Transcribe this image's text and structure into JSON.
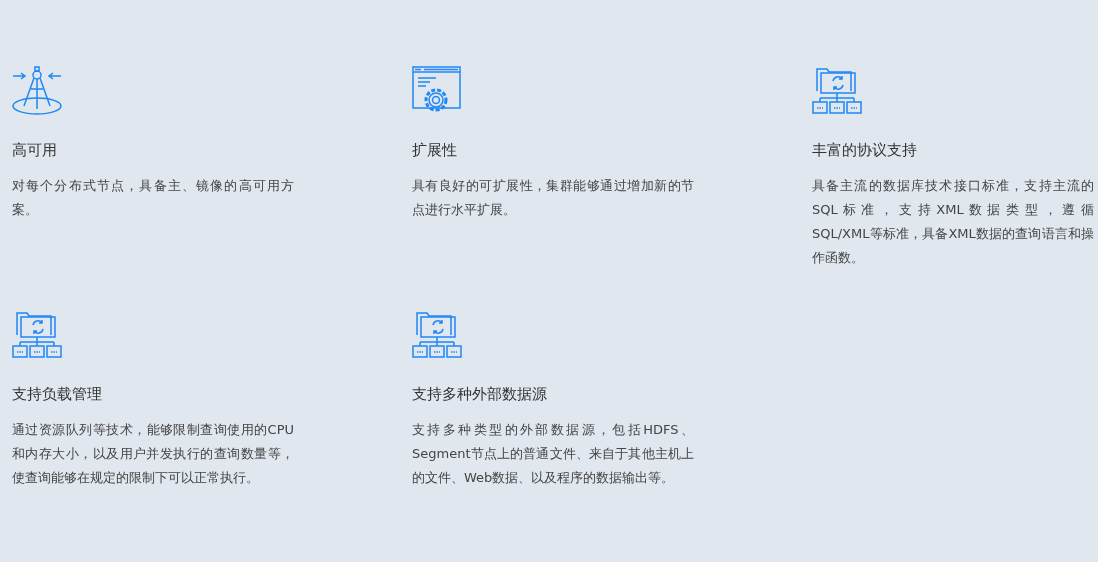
{
  "features": [
    {
      "kind": "compass",
      "title": "高可用",
      "description": "对每个分布式节点，具备主、镜像的高可用方案。"
    },
    {
      "kind": "settings",
      "title": "扩展性",
      "description": "具有良好的可扩展性，集群能够通过增加新的节点进行水平扩展。"
    },
    {
      "kind": "folders",
      "title": "丰富的协议支持",
      "description": "具备主流的数据库技术接口标准，支持主流的SQL 标 准 ， 支 持 XML 数 据 类 型 ， 遵 循 SQL/XML等标准，具备XML数据的查询语言和操作函数。"
    },
    {
      "kind": "folders",
      "title": "支持负载管理",
      "description": "通过资源队列等技术，能够限制查询使用的CPU和内存大小，以及用户并发执行的查询数量等，使查询能够在规定的限制下可以正常执行。"
    },
    {
      "kind": "folders",
      "title": "支持多种外部数据源",
      "description": "支持多种类型的外部数据源，包括HDFS、Segment节点上的普通文件、来自于其他主机上的文件、Web数据、以及程序的数据输出等。"
    }
  ]
}
